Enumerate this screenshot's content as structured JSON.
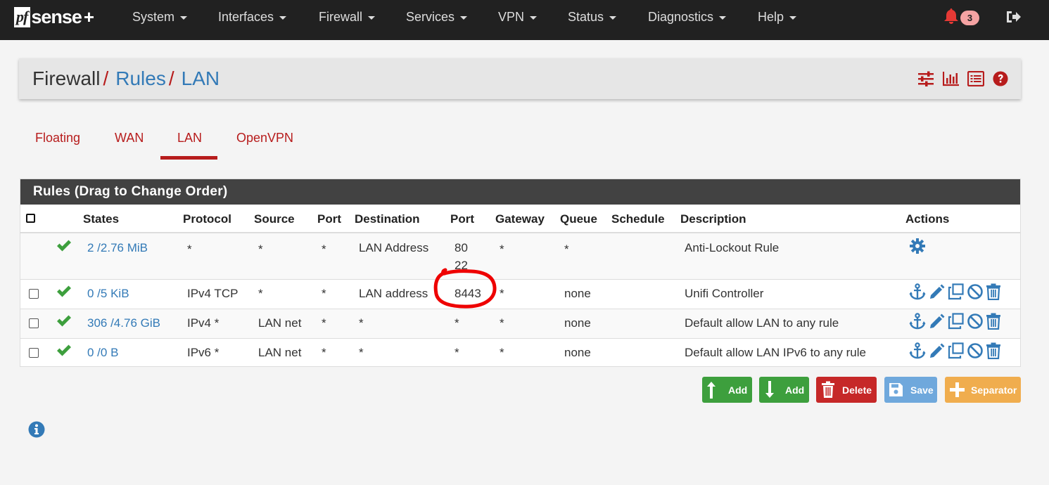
{
  "app": {
    "logo_prefix": "pf",
    "logo_name": "sense",
    "logo_plus": "+"
  },
  "nav": {
    "items": [
      {
        "label": "System"
      },
      {
        "label": "Interfaces"
      },
      {
        "label": "Firewall"
      },
      {
        "label": "Services"
      },
      {
        "label": "VPN"
      },
      {
        "label": "Status"
      },
      {
        "label": "Diagnostics"
      },
      {
        "label": "Help"
      }
    ],
    "notification_count": "3",
    "icons": [
      "bell-icon",
      "logout-icon"
    ]
  },
  "breadcrumb": {
    "part1": "Firewall",
    "part2": "Rules",
    "part3": "LAN",
    "separator": "/",
    "icons": [
      "sliders-icon",
      "chart-icon",
      "list-icon",
      "help-icon"
    ]
  },
  "tabs": [
    {
      "label": "Floating"
    },
    {
      "label": "WAN"
    },
    {
      "label": "LAN",
      "active": true
    },
    {
      "label": "OpenVPN"
    }
  ],
  "rules_panel": {
    "title": "Rules (Drag to Change Order)",
    "columns": [
      "States",
      "Protocol",
      "Source",
      "Port",
      "Destination",
      "Port",
      "Gateway",
      "Queue",
      "Schedule",
      "Description",
      "Actions"
    ],
    "rows": [
      {
        "states": "2 /2.76 MiB",
        "protocol": "*",
        "source": "*",
        "port": "*",
        "destination": "LAN Address",
        "dest_port": "80",
        "dest_port2": "22",
        "gateway": "*",
        "queue": "*",
        "schedule": "",
        "description": "Anti-Lockout Rule"
      },
      {
        "states": "0 /5 KiB",
        "protocol": "IPv4 TCP",
        "source": "*",
        "port": "*",
        "destination": "LAN address",
        "dest_port": "8443",
        "gateway": "*",
        "queue": "none",
        "schedule": "",
        "description": "Unifi Controller"
      },
      {
        "states": "306 /4.76 GiB",
        "protocol": "IPv4 *",
        "source": "LAN net",
        "port": "*",
        "destination": "*",
        "dest_port": "*",
        "gateway": "*",
        "queue": "none",
        "schedule": "",
        "description": "Default allow LAN to any rule"
      },
      {
        "states": "0 /0 B",
        "protocol": "IPv6 *",
        "source": "LAN net",
        "port": "*",
        "destination": "*",
        "dest_port": "*",
        "gateway": "*",
        "queue": "none",
        "schedule": "",
        "description": "Default allow LAN IPv6 to any rule"
      }
    ]
  },
  "buttons": {
    "add_top": "Add",
    "add_bottom": "Add",
    "delete": "Delete",
    "save": "Save",
    "separator": "Separator"
  },
  "colors": {
    "nav_bg": "#212121",
    "accent_red": "#b71c1c",
    "link_blue": "#337ab7",
    "check_green": "#3d9f3d",
    "annotation_red": "#ee0000"
  }
}
